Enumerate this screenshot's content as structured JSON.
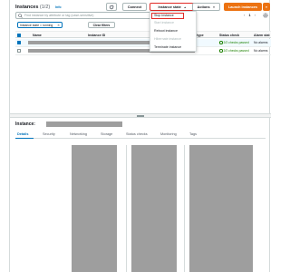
{
  "header": {
    "title": "Instances",
    "count": "(1/2)",
    "info": "Info"
  },
  "toolbar": {
    "refresh_icon": "refresh-icon",
    "connect_label": "Connect",
    "instance_state_label": "Instance state",
    "actions_label": "Actions",
    "launch_label": "Launch instances"
  },
  "search": {
    "placeholder": "Find instance by attribute or tag (case-sensitive)"
  },
  "pager": {
    "page": "1"
  },
  "filters": {
    "chip_label": "Instance state = running",
    "clear_label": "Clear filters"
  },
  "table": {
    "columns": [
      "Name",
      "Instance ID",
      "Instance state",
      "Instance type",
      "Status check",
      "Alarm status"
    ],
    "header_visible": {
      "name": "Name",
      "instance_id": "Instance ID",
      "instance_type": "ance type",
      "status_check": "Status check",
      "alarm_status": "Alarm stat"
    },
    "rows": [
      {
        "selected": true,
        "status_check": "2/2 checks passed",
        "alarm": "No alarms"
      },
      {
        "selected": false,
        "status_check": "2/2 checks passed",
        "alarm": "No alarms"
      }
    ]
  },
  "dropdown": {
    "items": [
      "Stop instance",
      "Start instance",
      "Reboot instance",
      "Hibernate instance",
      "Terminate instance"
    ]
  },
  "details": {
    "title_prefix": "Instance:",
    "tabs": [
      "Details",
      "Security",
      "Networking",
      "Storage",
      "Status checks",
      "Monitoring",
      "Tags"
    ]
  },
  "colors": {
    "accent": "#0073bb",
    "launch": "#ec7211",
    "highlight": "#e02a26",
    "success": "#1d8102"
  }
}
